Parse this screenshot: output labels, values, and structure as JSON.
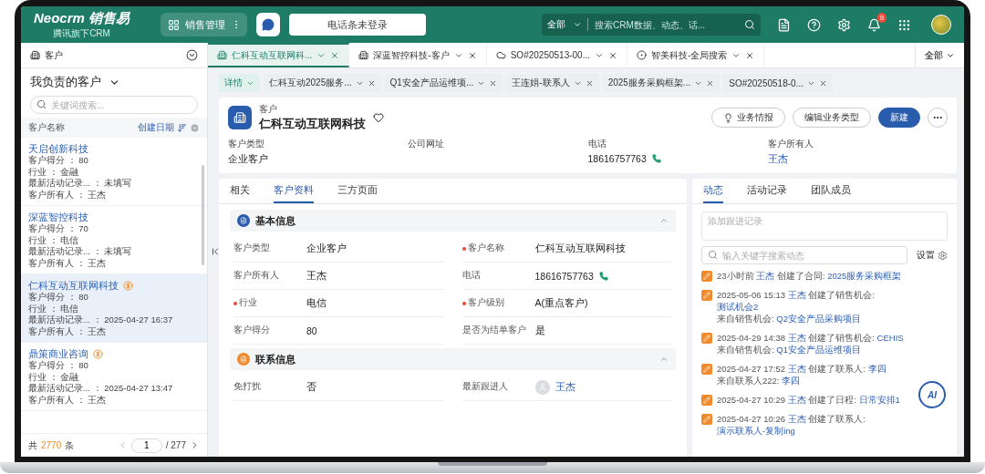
{
  "topbar": {
    "logo": "Neocrm 销售易",
    "logo_subtitle": "腾讯旗下CRM",
    "app_menu": "销售管理",
    "phone_status": "电话条未登录",
    "search": {
      "scope": "全部",
      "placeholder": "搜索CRM数据、动态、话..."
    },
    "notifications": "9"
  },
  "tabbar": {
    "module": "客户",
    "tabs": [
      {
        "label": "仁科互动互联网科...",
        "kind": "record",
        "selected": true
      },
      {
        "label": "深蓝智控科技-客户",
        "kind": "record",
        "selected": false
      },
      {
        "label": "SO#20250513-00...",
        "kind": "order",
        "selected": false
      },
      {
        "label": "智美科技-全局搜索",
        "kind": "search",
        "selected": false
      }
    ],
    "all_menu": "全部"
  },
  "list_panel": {
    "title": "我负责的客户",
    "search_placeholder": "关键词搜索...",
    "column_name": "客户名称",
    "sort_label": "创建日期",
    "items": [
      {
        "name": "天启创新科技",
        "badge": false,
        "selected": false,
        "fields": [
          "客户得分 ： 80",
          "行业 ： 金融",
          "最新活动记录... ： 未填写",
          "客户所有人 ： 王杰"
        ]
      },
      {
        "name": "深蓝智控科技",
        "badge": false,
        "selected": false,
        "fields": [
          "客户得分 ： 70",
          "行业 ： 电信",
          "最新活动记录... ： 未填写",
          "客户所有人 ： 王杰"
        ]
      },
      {
        "name": "仁科互动互联网科技",
        "badge": true,
        "selected": true,
        "fields": [
          "客户得分 ： 80",
          "行业 ： 电信",
          "最新活动记录... ： 2025-04-27 16:37",
          "客户所有人 ： 王杰"
        ]
      },
      {
        "name": "鼎策商业咨询",
        "badge": true,
        "selected": false,
        "fields": [
          "客户得分 ： 80",
          "行业 ： 金融",
          "最新活动记录... ： 2025-04-27 13:47",
          "客户所有人 ： 王杰"
        ]
      }
    ],
    "footer": {
      "prefix": "共",
      "count": "2770",
      "suffix": "条",
      "page": "1",
      "pages": "/ 277"
    }
  },
  "subtabs": [
    {
      "label": "详情",
      "selected": true
    },
    {
      "label": "仁科互动2025服务...",
      "selected": false
    },
    {
      "label": "Q1安全产品运维项...",
      "selected": false
    },
    {
      "label": "王连娟-联系人",
      "selected": false
    },
    {
      "label": "2025服务采购框架...",
      "selected": false
    },
    {
      "label": "SO#20250518-0...",
      "selected": false
    }
  ],
  "record": {
    "type_label": "客户",
    "name": "仁科互动互联网科技",
    "buttons": [
      {
        "label": "业务情报",
        "kind": "icon"
      },
      {
        "label": "编辑业务类型",
        "kind": "outline"
      },
      {
        "label": "新建",
        "kind": "primary"
      }
    ],
    "fields": [
      {
        "label": "客户类型",
        "value": "企业客户",
        "kind": "text"
      },
      {
        "label": "公司网址",
        "kind": "text"
      },
      {
        "label": "电话",
        "value": "18616757763",
        "kind": "phone"
      },
      {
        "label": "客户所有人",
        "value": "王杰",
        "kind": "link"
      }
    ]
  },
  "detail_tabs": [
    {
      "label": "相关",
      "selected": false
    },
    {
      "label": "客户资料",
      "selected": true
    },
    {
      "label": "三方页面",
      "selected": false
    }
  ],
  "sections": [
    {
      "title": "基本信息",
      "color": "#2a5cae",
      "expanded": true,
      "fields": [
        {
          "label": "客户类型",
          "value": "企业客户",
          "required": false,
          "kind": "text"
        },
        {
          "label": "客户名称",
          "value": "仁科互动互联网科技",
          "required": true,
          "kind": "text"
        },
        {
          "label": "客户所有人",
          "value": "王杰",
          "required": false,
          "kind": "text"
        },
        {
          "label": "电话",
          "value": "18616757763",
          "required": false,
          "kind": "phone"
        },
        {
          "label": "行业",
          "value": "电信",
          "required": true,
          "kind": "text"
        },
        {
          "label": "客户级别",
          "value": "A(重点客户)",
          "required": true,
          "kind": "text"
        },
        {
          "label": "客户得分",
          "value": "80",
          "required": false,
          "kind": "text"
        },
        {
          "label": "是否为结单客户",
          "value": "是",
          "required": false,
          "kind": "text"
        }
      ]
    },
    {
      "title": "联系信息",
      "color": "#f08a2a",
      "expanded": true,
      "fields": [
        {
          "label": "免打扰",
          "value": "否",
          "required": false,
          "kind": "text"
        },
        {
          "label": "最新跟进人",
          "value": "王杰",
          "required": false,
          "kind": "person"
        }
      ]
    }
  ],
  "feed": {
    "tabs": [
      {
        "label": "动态",
        "selected": true
      },
      {
        "label": "活动记录",
        "selected": false
      },
      {
        "label": "团队成员",
        "selected": false
      }
    ],
    "note_placeholder": "添加跟进记录",
    "search_placeholder": "输入关键字搜索动态",
    "settings_label": "设置",
    "entries": [
      {
        "lines": [
          [
            {
              "text": "23小时前 "
            },
            {
              "text": "王杰",
              "link": true
            },
            {
              "text": " 创建了合同: "
            },
            {
              "text": "2025服务采购框架",
              "link": true
            }
          ]
        ]
      },
      {
        "lines": [
          [
            {
              "text": "2025-05-06 15:13 "
            },
            {
              "text": "王杰",
              "link": true
            },
            {
              "text": " 创建了销售机会: "
            },
            {
              "text": "测试机会2",
              "link": true
            }
          ],
          [
            {
              "text": "来自销售机会: "
            },
            {
              "text": "Q2安全产品采购项目",
              "link": true
            }
          ]
        ]
      },
      {
        "lines": [
          [
            {
              "text": "2025-04-29 14:38 "
            },
            {
              "text": "王杰",
              "link": true
            },
            {
              "text": " 创建了销售机会: "
            },
            {
              "text": "CEHIS",
              "link": true
            }
          ],
          [
            {
              "text": "来自销售机会: "
            },
            {
              "text": "Q1安全产品运维项目",
              "link": true
            }
          ]
        ]
      },
      {
        "lines": [
          [
            {
              "text": "2025-04-27 17:52 "
            },
            {
              "text": "王杰",
              "link": true
            },
            {
              "text": " 创建了联系人: "
            },
            {
              "text": "李四",
              "link": true
            }
          ],
          [
            {
              "text": "来自联系人222: "
            },
            {
              "text": "李四",
              "link": true
            }
          ]
        ]
      },
      {
        "lines": [
          [
            {
              "text": "2025-04-27 10:29 "
            },
            {
              "text": "王杰",
              "link": true
            },
            {
              "text": " 创建了日程: "
            },
            {
              "text": "日常安排1",
              "link": true
            }
          ]
        ]
      },
      {
        "lines": [
          [
            {
              "text": "2025-04-27 10:26 "
            },
            {
              "text": "王杰",
              "link": true
            },
            {
              "text": " 创建了联系人: "
            },
            {
              "text": "演示联系人-复制ing",
              "link": true
            }
          ]
        ]
      }
    ]
  },
  "ai_button": "AI"
}
